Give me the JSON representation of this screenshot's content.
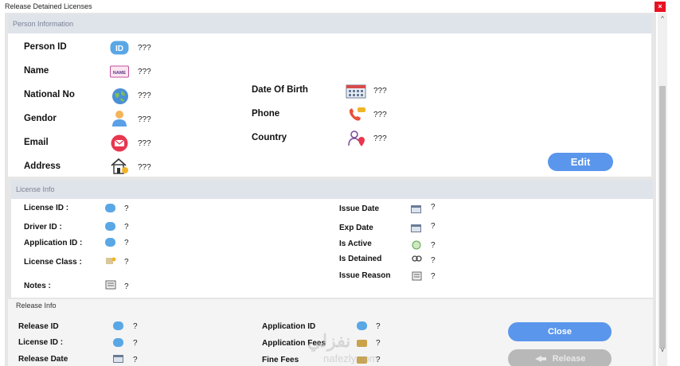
{
  "window": {
    "title": "Release Detained Licenses",
    "close_glyph": "×"
  },
  "scrollbar": {
    "up": "^",
    "down": "v"
  },
  "person_info": {
    "header": "Person Information",
    "person_id_label": "Person ID",
    "person_id_value": "???",
    "name_label": "Name",
    "name_value": "???",
    "national_no_label": "National No",
    "national_no_value": "???",
    "gendor_label": "Gendor",
    "gendor_value": "???",
    "email_label": "Email",
    "email_value": "???",
    "address_label": "Address",
    "address_value": "???",
    "dob_label": "Date Of Birth",
    "dob_value": "???",
    "phone_label": "Phone",
    "phone_value": "???",
    "country_label": "Country",
    "country_value": "???",
    "edit_label": "Edit",
    "name_icon_text": "NAME",
    "id_icon_text": "ID"
  },
  "license_info": {
    "header": "License Info",
    "license_id_label": "License ID :",
    "license_id_value": "?",
    "driver_id_label": "Driver ID :",
    "driver_id_value": "?",
    "application_id_label": "Application ID :",
    "application_id_value": "?",
    "license_class_label": "License Class :",
    "license_class_value": "?",
    "notes_label": "Notes :",
    "notes_value": "?",
    "issue_date_label": "Issue Date",
    "issue_date_value": "?",
    "exp_date_label": "Exp Date",
    "exp_date_value": "?",
    "is_active_label": "Is Active",
    "is_active_value": "?",
    "is_detained_label": "Is Detained",
    "is_detained_value": "?",
    "issue_reason_label": "Issue Reason",
    "issue_reason_value": "?"
  },
  "release_info": {
    "header": "Release Info",
    "release_id_label": "Release ID",
    "release_id_value": "?",
    "license_id_label": "License ID :",
    "license_id_value": "?",
    "release_date_label": "Release  Date",
    "release_date_value": "?",
    "application_id_label": "Application ID",
    "application_id_value": "?",
    "application_fees_label": "Application Fees",
    "application_fees_value": "?",
    "fine_fees_label": "Fine Fees",
    "fine_fees_value": "?",
    "close_label": "Close",
    "release_label": "Release"
  },
  "watermark": {
    "arabic": "نفزلي",
    "latin": "nafezly.com"
  },
  "colors": {
    "accent": "#5a96ec",
    "header_bg": "#dfe3ea",
    "disabled": "#b8b8b8",
    "close_red": "#e81123"
  },
  "icons": [
    "id-badge-icon",
    "name-tag-icon",
    "globe-icon",
    "person-icon",
    "email-icon",
    "house-icon",
    "calendar-icon",
    "phone-icon",
    "location-person-icon",
    "notes-icon",
    "class-icon",
    "active-icon",
    "detained-icon"
  ]
}
